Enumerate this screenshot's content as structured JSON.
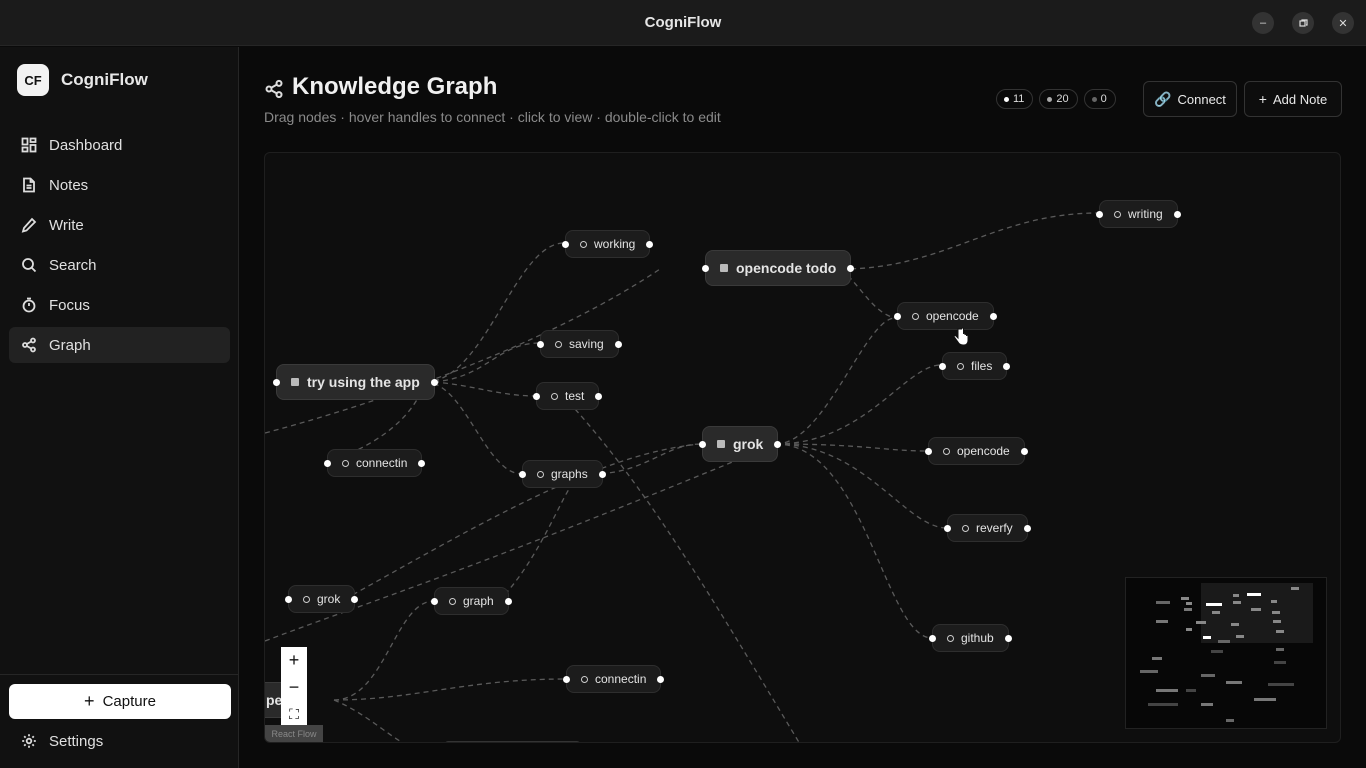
{
  "window": {
    "title": "CogniFlow",
    "controls": [
      "minimize-icon",
      "maximize-icon",
      "close-icon"
    ]
  },
  "sidebar": {
    "logo": "CF",
    "brand": "CogniFlow",
    "items": [
      {
        "label": "Dashboard",
        "icon": "dashboard-icon"
      },
      {
        "label": "Notes",
        "icon": "file-icon"
      },
      {
        "label": "Write",
        "icon": "pen-icon"
      },
      {
        "label": "Search",
        "icon": "search-icon"
      },
      {
        "label": "Focus",
        "icon": "timer-icon"
      },
      {
        "label": "Graph",
        "icon": "share-icon",
        "active": true
      }
    ],
    "capture": "Capture",
    "settings": "Settings"
  },
  "header": {
    "title": "Knowledge Graph",
    "subtitle": "Drag nodes · hover handles to connect · click to view · double-click to edit",
    "stats": [
      {
        "value": "11",
        "color": "#ffffff"
      },
      {
        "value": "20",
        "color": "#aaaaaa"
      },
      {
        "value": "0",
        "color": "#666666"
      }
    ],
    "connect_label": "Connect",
    "add_note_label": "Add Note"
  },
  "graph": {
    "nodes": [
      {
        "id": "writing",
        "label": "writing",
        "kind": "note"
      },
      {
        "id": "working",
        "label": "working",
        "kind": "note"
      },
      {
        "id": "opencode-todo",
        "label": "opencode todo",
        "kind": "tag"
      },
      {
        "id": "opencode1",
        "label": "opencode",
        "kind": "note"
      },
      {
        "id": "saving",
        "label": "saving",
        "kind": "note"
      },
      {
        "id": "files",
        "label": "files",
        "kind": "note"
      },
      {
        "id": "try-app",
        "label": "try using the app",
        "kind": "tag"
      },
      {
        "id": "test",
        "label": "test",
        "kind": "note"
      },
      {
        "id": "grok-main",
        "label": "grok",
        "kind": "tag"
      },
      {
        "id": "opencode2",
        "label": "opencode",
        "kind": "note"
      },
      {
        "id": "connectin1",
        "label": "connectin",
        "kind": "note"
      },
      {
        "id": "graphs",
        "label": "graphs",
        "kind": "note"
      },
      {
        "id": "reverfy",
        "label": "reverfy",
        "kind": "note"
      },
      {
        "id": "grok2",
        "label": "grok",
        "kind": "note"
      },
      {
        "id": "graph",
        "label": "graph",
        "kind": "note"
      },
      {
        "id": "github",
        "label": "github",
        "kind": "note"
      },
      {
        "id": "connectin2",
        "label": "connectin",
        "kind": "note"
      },
      {
        "id": "pe-partial",
        "label": "pe",
        "kind": "tag"
      }
    ],
    "zoom_controls": [
      "+",
      "−",
      "⛶"
    ],
    "attribution": "React Flow"
  }
}
